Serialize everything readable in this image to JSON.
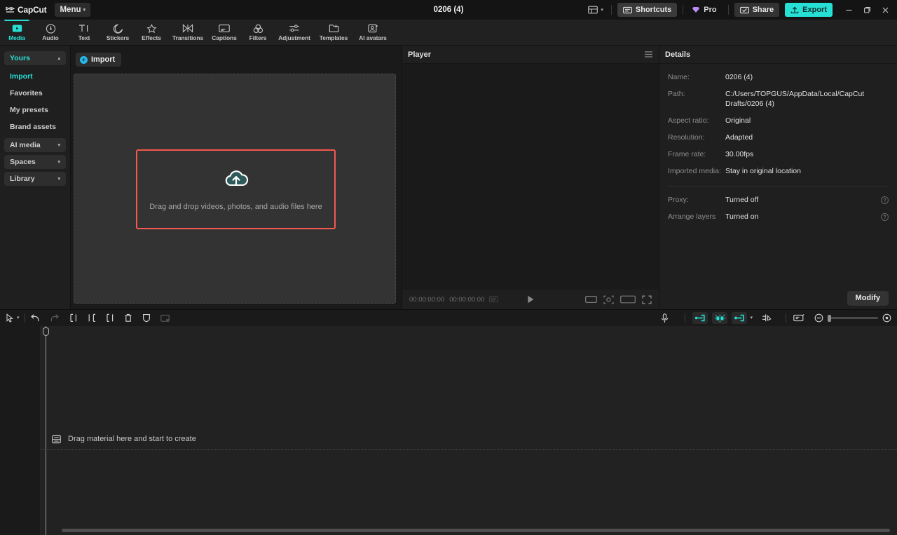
{
  "titlebar": {
    "brand_name": "CapCut",
    "brand_logo_icon": "capcut-logo-icon",
    "menu_label": "Menu",
    "doc_title": "0206 (4)",
    "layout_icon": "layout-grid-icon",
    "shortcuts_label": "Shortcuts",
    "shortcuts_icon": "keyboard-icon",
    "pro_label": "Pro",
    "pro_icon": "diamond-icon",
    "share_label": "Share",
    "share_icon": "share-screen-icon",
    "export_label": "Export",
    "export_icon": "upload-icon",
    "minimize_label": "–",
    "maximize_label": "❐",
    "close_label": "✕",
    "accent_color": "#27e0d5"
  },
  "tabs": [
    {
      "label": "Media",
      "icon": "media-play-icon",
      "active": true
    },
    {
      "label": "Audio",
      "icon": "audio-disc-icon",
      "active": false
    },
    {
      "label": "Text",
      "icon": "text-ti-icon",
      "active": false
    },
    {
      "label": "Stickers",
      "icon": "sticker-icon",
      "active": false
    },
    {
      "label": "Effects",
      "icon": "effects-star-icon",
      "active": false
    },
    {
      "label": "Transitions",
      "icon": "transitions-icon",
      "active": false
    },
    {
      "label": "Captions",
      "icon": "captions-icon",
      "active": false
    },
    {
      "label": "Filters",
      "icon": "filters-icon",
      "active": false
    },
    {
      "label": "Adjustment",
      "icon": "adjustment-sliders-icon",
      "active": false
    },
    {
      "label": "Templates",
      "icon": "templates-icon",
      "active": false
    },
    {
      "label": "AI avatars",
      "icon": "ai-avatar-icon",
      "active": false
    }
  ],
  "sidebar": {
    "items": [
      {
        "label": "Yours",
        "type": "group",
        "expanded": true,
        "selected": true
      },
      {
        "label": "Import",
        "type": "link",
        "active": true
      },
      {
        "label": "Favorites",
        "type": "link",
        "active": false
      },
      {
        "label": "My presets",
        "type": "link",
        "active": false
      },
      {
        "label": "Brand assets",
        "type": "link",
        "active": false
      },
      {
        "label": "AI media",
        "type": "group",
        "expanded": false,
        "selected": false
      },
      {
        "label": "Spaces",
        "type": "group",
        "expanded": false,
        "selected": false
      },
      {
        "label": "Library",
        "type": "group",
        "expanded": false,
        "selected": false
      }
    ]
  },
  "media": {
    "import_label": "Import",
    "import_icon": "plus-circle-icon",
    "dropzone_icon": "cloud-upload-icon",
    "dropzone_text": "Drag and drop videos, photos, and audio files here",
    "highlight_color": "#f4584f"
  },
  "player": {
    "title": "Player",
    "menu_icon": "hamburger-icon",
    "current_time": "00:00:00:00",
    "total_time": "00:00:00:00",
    "keyboard_icon": "keyboard-small-icon",
    "play_icon": "play-icon",
    "ratio_icon": "aspect-ratio-icon",
    "magnify_icon": "magnifier-icon",
    "fit_icon": "fit-screen-icon",
    "fullscreen_icon": "fullscreen-icon"
  },
  "details": {
    "title": "Details",
    "rows": [
      {
        "label": "Name:",
        "value": "0206 (4)",
        "help": false
      },
      {
        "label": "Path:",
        "value": "C:/Users/TOPGUS/AppData/Local/CapCut Drafts/0206 (4)",
        "help": false
      },
      {
        "label": "Aspect ratio:",
        "value": "Original",
        "help": false
      },
      {
        "label": "Resolution:",
        "value": "Adapted",
        "help": false
      },
      {
        "label": "Frame rate:",
        "value": "30.00fps",
        "help": false
      },
      {
        "label": "Imported media:",
        "value": "Stay in original location",
        "help": false
      }
    ],
    "rows2": [
      {
        "label": "Proxy:",
        "value": "Turned off",
        "help": true
      },
      {
        "label": "Arrange layers",
        "value": "Turned on",
        "help": true
      }
    ],
    "help_glyph": "?",
    "modify_label": "Modify"
  },
  "timeline": {
    "tools": [
      {
        "name": "select-cursor-tool",
        "icon": "cursor-arrow-icon",
        "dim": false
      },
      {
        "name": "tool-dropdown",
        "icon": "chevron-down-icon",
        "dim": false
      },
      {
        "name": "undo-button",
        "icon": "undo-icon",
        "dim": false
      },
      {
        "name": "redo-button",
        "icon": "redo-icon",
        "dim": true
      },
      {
        "name": "split-button",
        "icon": "split-icon",
        "dim": false
      },
      {
        "name": "trim-left-button",
        "icon": "trim-left-icon",
        "dim": false
      },
      {
        "name": "trim-right-button",
        "icon": "trim-right-icon",
        "dim": false
      },
      {
        "name": "delete-button",
        "icon": "trash-icon",
        "dim": false
      },
      {
        "name": "mask-button",
        "icon": "shield-icon",
        "dim": false
      },
      {
        "name": "crop-button",
        "icon": "crop-disabled-icon",
        "dim": true
      }
    ],
    "right_tools": [
      {
        "name": "record-voiceover-button",
        "icon": "microphone-icon"
      },
      {
        "name": "keyframe-toggle-1",
        "icon": "link-clip-icon"
      },
      {
        "name": "keyframe-toggle-2",
        "icon": "auto-adjust-icon"
      },
      {
        "name": "keyframe-toggle-3",
        "icon": "link-clip-icon"
      },
      {
        "name": "keyframe-dropdown",
        "icon": "chevron-down-icon"
      },
      {
        "name": "snap-toggle",
        "icon": "magnet-snap-icon"
      },
      {
        "name": "preview-toggle",
        "icon": "preview-window-icon"
      },
      {
        "name": "zoom-out-button",
        "icon": "zoom-out-icon"
      },
      {
        "name": "zoom-slider",
        "icon": "slider-icon"
      },
      {
        "name": "zoom-in-button",
        "icon": "zoom-in-icon"
      }
    ],
    "track_hint_text": "Drag material here and start to create",
    "track_hint_icon": "material-track-icon",
    "zoom_level": 0
  }
}
